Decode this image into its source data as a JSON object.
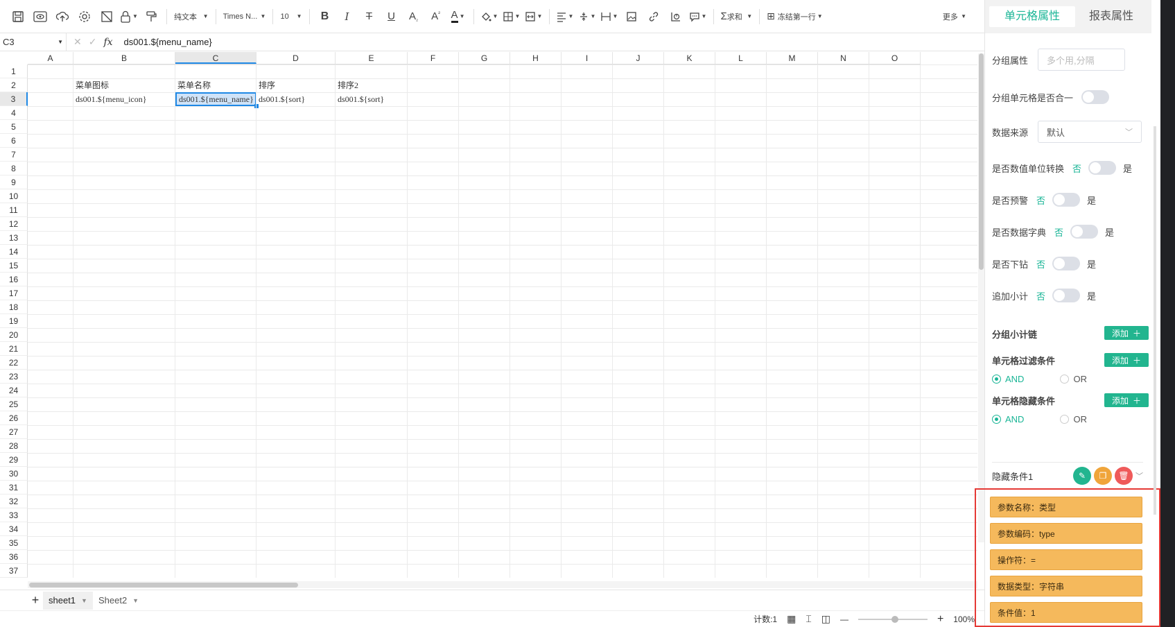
{
  "toolbar": {
    "text_type": "纯文本",
    "font": "Times N...",
    "font_size": "10",
    "sum_label": "求和",
    "freeze_label": "冻结第一行",
    "more_label": "更多"
  },
  "formula": {
    "cell_ref": "C3",
    "fx_label": "fx",
    "value": "ds001.${menu_name}"
  },
  "grid": {
    "columns": [
      "A",
      "B",
      "C",
      "D",
      "E",
      "F",
      "G",
      "H",
      "I",
      "J",
      "K",
      "L",
      "M",
      "N",
      "O"
    ],
    "rows": [
      "1",
      "2",
      "3",
      "4",
      "5",
      "6",
      "7",
      "8",
      "9",
      "10",
      "11",
      "12",
      "13",
      "14",
      "15",
      "16",
      "17",
      "18",
      "19",
      "20",
      "21",
      "22",
      "23",
      "24",
      "25",
      "26",
      "27",
      "28",
      "29",
      "30",
      "31",
      "32",
      "33",
      "34",
      "35",
      "36",
      "37"
    ],
    "cells": {
      "b2": "菜单图标",
      "c2": "菜单名称",
      "d2": "排序",
      "e2": "排序2",
      "b3": "ds001.${menu_icon}",
      "c3": "ds001.${menu_name}",
      "d3": "ds001.${sort}",
      "e3": "ds001.${sort}"
    }
  },
  "sheets": {
    "add_label": "+",
    "tabs": [
      "sheet1",
      "Sheet2"
    ]
  },
  "status": {
    "count_label": "计数:1",
    "zoom_minus": "—",
    "zoom_plus": "+",
    "zoom": "100%"
  },
  "panel": {
    "tabs": [
      "单元格属性",
      "报表属性"
    ],
    "group_attr_label": "分组属性",
    "group_attr_placeholder": "多个用,分隔",
    "merge_label": "分组单元格是否合一",
    "datasource_label": "数据来源",
    "datasource_value": "默认",
    "switches": [
      {
        "label": "是否数值单位转换",
        "no": "否",
        "yes": "是"
      },
      {
        "label": "是否预警",
        "no": "否",
        "yes": "是"
      },
      {
        "label": "是否数据字典",
        "no": "否",
        "yes": "是"
      },
      {
        "label": "是否下钻",
        "no": "否",
        "yes": "是"
      },
      {
        "label": "追加小计",
        "no": "否",
        "yes": "是"
      }
    ],
    "subtotal_label": "分组小计链",
    "filter_label": "单元格过滤条件",
    "hide_label": "单元格隐藏条件",
    "add_label": "添加",
    "and_label": "AND",
    "or_label": "OR",
    "hide_condition_title": "隐藏条件1",
    "condition_cards": [
      "参数名称：类型",
      "参数编码：type",
      "操作符：=",
      "数据类型：字符串",
      "条件值：1"
    ]
  },
  "colors": {
    "accent": "#19b596",
    "add_button": "#22b58f",
    "card": "#f5b95c",
    "highlight_box": "#e53935",
    "selection": "#1e88e5"
  }
}
